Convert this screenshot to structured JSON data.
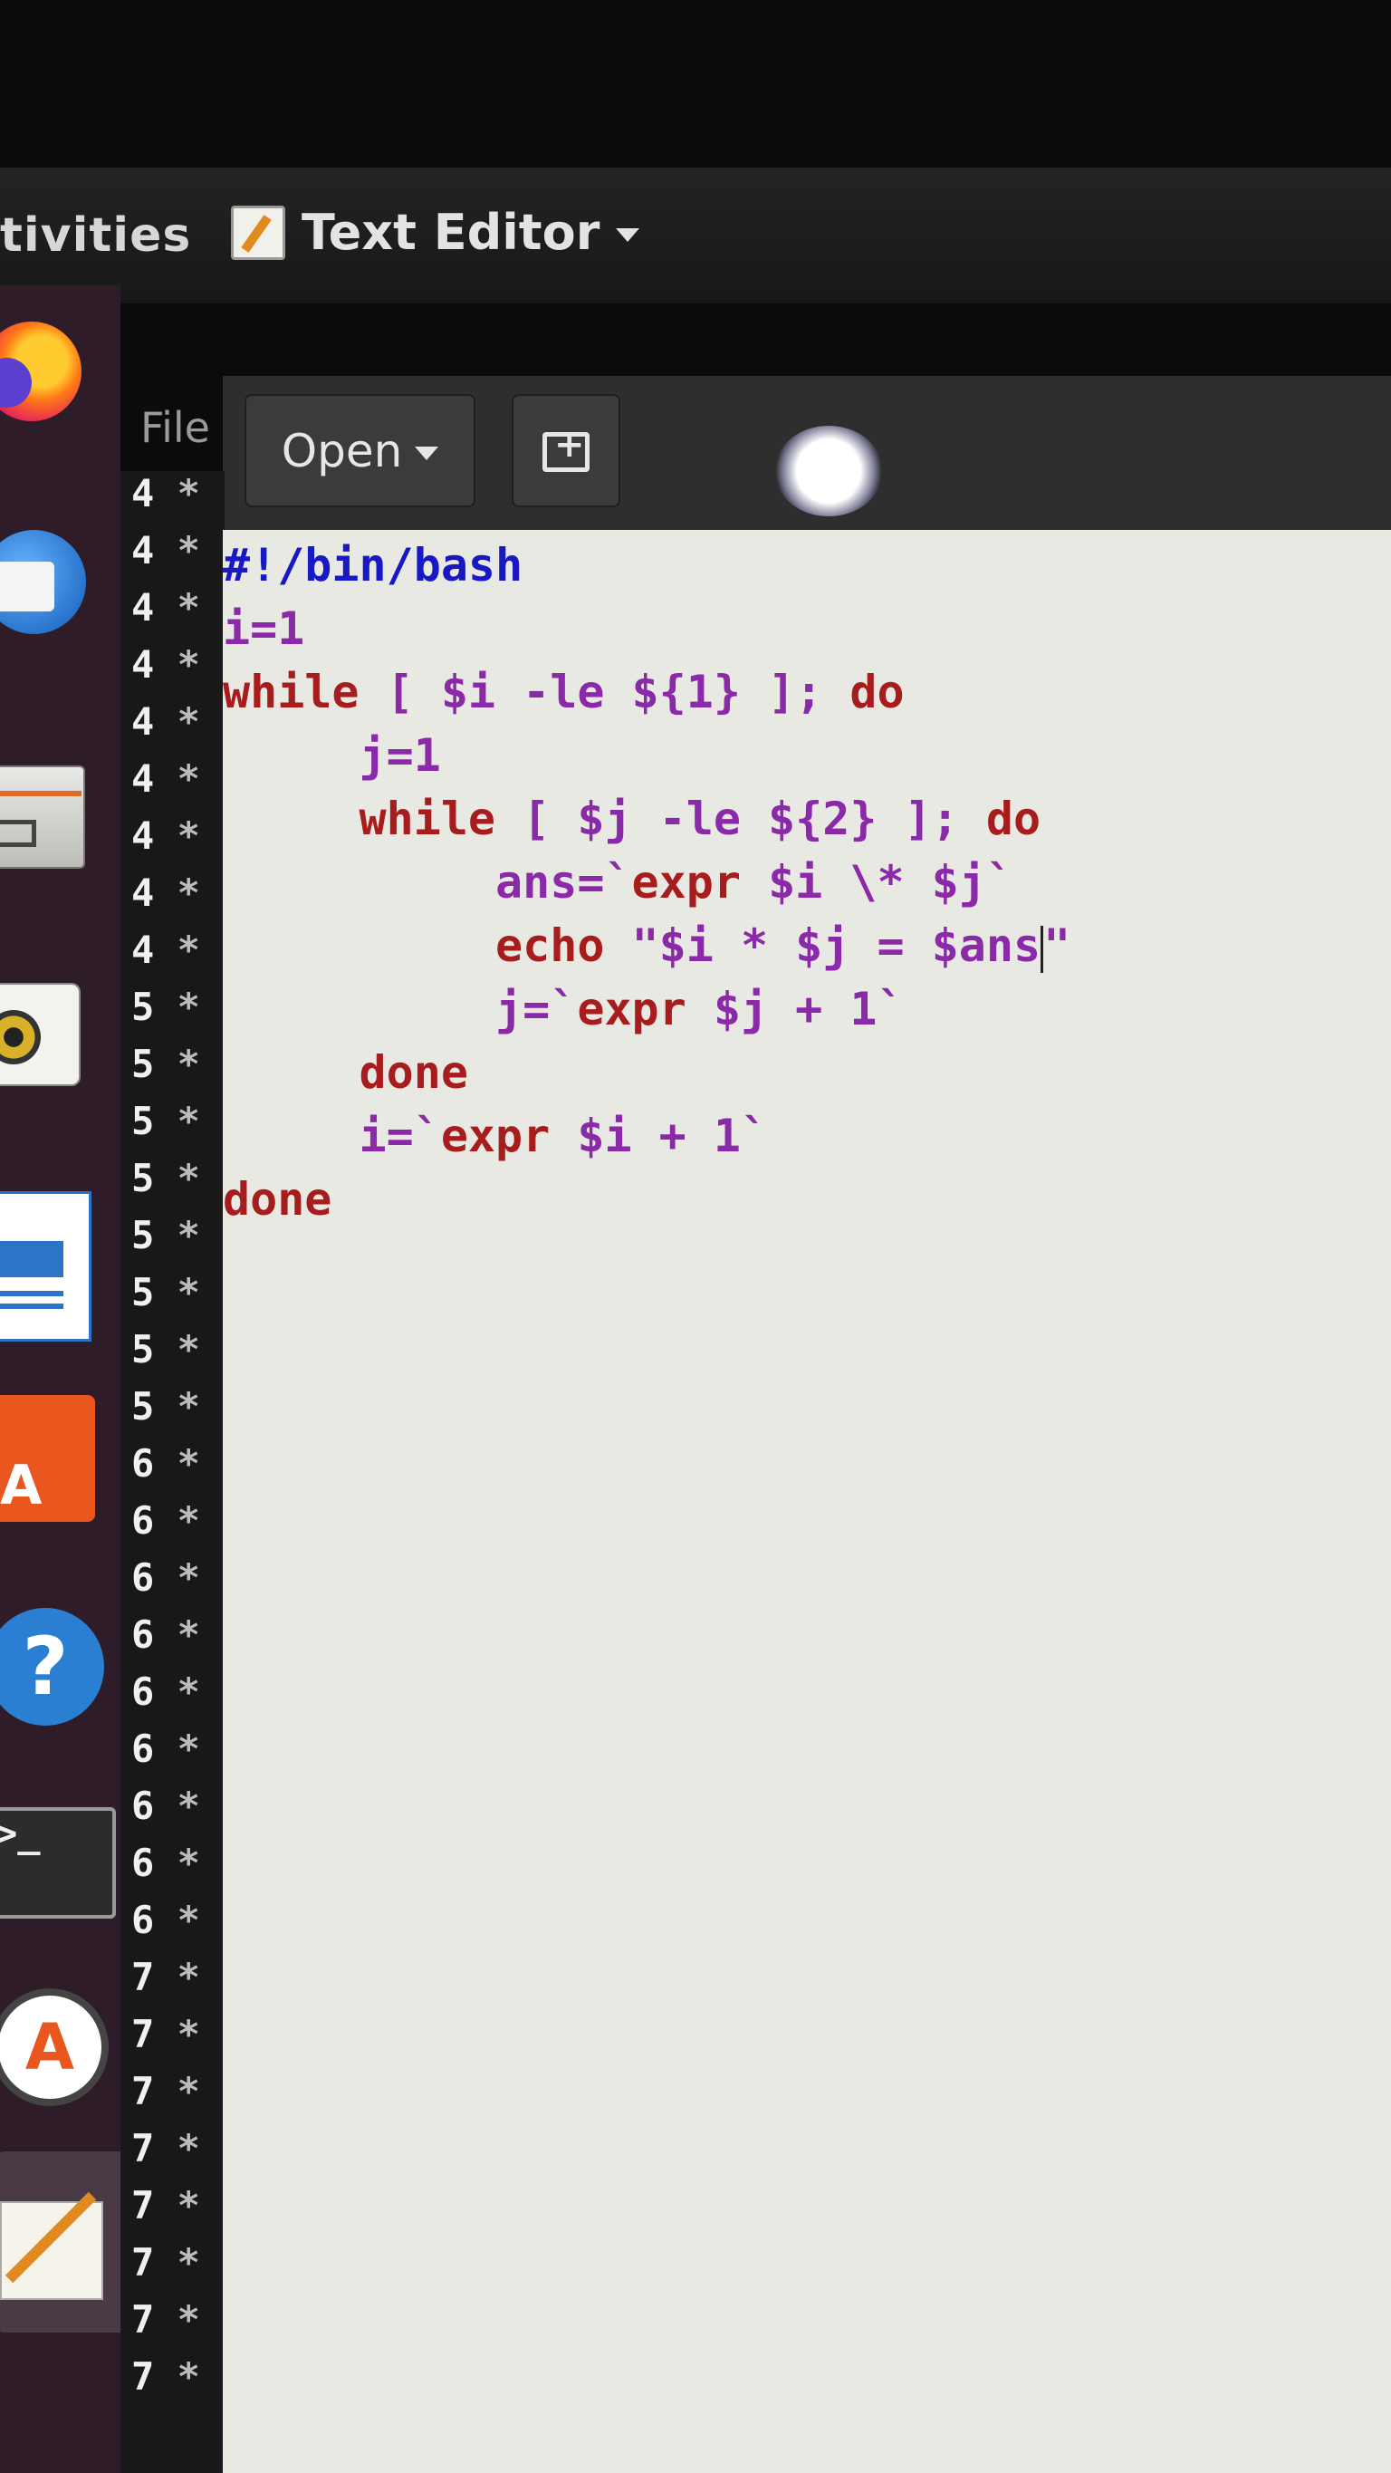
{
  "topbar": {
    "activities_label": "tivities",
    "app_name": "Text Editor"
  },
  "editor": {
    "file_menu_label": "File",
    "open_label": "Open",
    "gutter": [
      {
        "num": "4"
      },
      {
        "num": "4"
      },
      {
        "num": "4"
      },
      {
        "num": "4"
      },
      {
        "num": "4"
      },
      {
        "num": "4"
      },
      {
        "num": "4"
      },
      {
        "num": "4"
      },
      {
        "num": "4"
      },
      {
        "num": "5"
      },
      {
        "num": "5"
      },
      {
        "num": "5"
      },
      {
        "num": "5"
      },
      {
        "num": "5"
      },
      {
        "num": "5"
      },
      {
        "num": "5"
      },
      {
        "num": "5"
      },
      {
        "num": "6"
      },
      {
        "num": "6"
      },
      {
        "num": "6"
      },
      {
        "num": "6"
      },
      {
        "num": "6"
      },
      {
        "num": "6"
      },
      {
        "num": "6"
      },
      {
        "num": "6"
      },
      {
        "num": "6"
      },
      {
        "num": "7"
      },
      {
        "num": "7"
      },
      {
        "num": "7"
      },
      {
        "num": "7"
      },
      {
        "num": "7"
      },
      {
        "num": "7"
      },
      {
        "num": "7"
      },
      {
        "num": "7"
      }
    ],
    "gutter_mark": "*",
    "code": {
      "line1": "#!/bin/bash",
      "line2": "i=1",
      "line3_kw1": "while",
      "line3_mid": " [ $i -le ${1} ]; ",
      "line3_kw2": "do",
      "line4": "     j=1",
      "line5_indent": "     ",
      "line5_kw1": "while",
      "line5_mid": " [ $j -le ${2} ]; ",
      "line5_kw2": "do",
      "line6_indent": "          ",
      "line6_a": "ans=`",
      "line6_kw": "expr",
      "line6_b": " $i \\* $j`",
      "line7_indent": "          ",
      "line7_kw": "echo",
      "line7_a": " \"$i * $j = $ans",
      "line7_b": "\"",
      "line8_indent": "          ",
      "line8_a": "j=`",
      "line8_kw": "expr",
      "line8_b": " $j + 1`",
      "line9_indent": "     ",
      "line9_kw": "done",
      "line10_indent": "     ",
      "line10_a": "i=`",
      "line10_kw": "expr",
      "line10_b": " $i + 1`",
      "line11_kw": "done"
    }
  },
  "colors": {
    "keyword": "#a71c1c",
    "shebang": "#1818c4",
    "text": "#8a2aa8",
    "editor_bg": "#e9e9e4",
    "dock_bg": "#2e1c28"
  }
}
